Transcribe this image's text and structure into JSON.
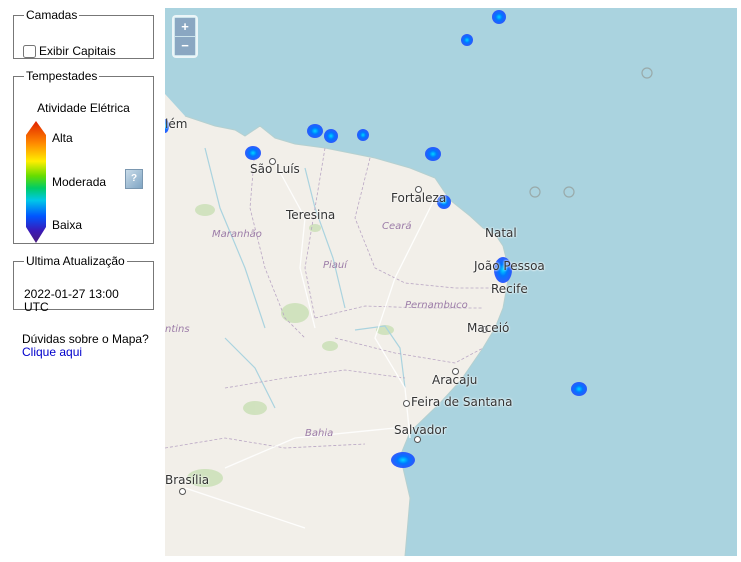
{
  "layers": {
    "legend": "Camadas",
    "show_capitals_label": "Exibir Capitais",
    "show_capitals_checked": false
  },
  "storms": {
    "legend": "Tempestades",
    "title": "Atividade Elétrica",
    "levels": {
      "high": "Alta",
      "moderate": "Moderada",
      "low": "Baixa"
    },
    "help_icon": "help-icon"
  },
  "update": {
    "legend": "Ultima Atualização",
    "timestamp": "2022-01-27 13:00 UTC"
  },
  "faq": {
    "question": "Dúvidas sobre o Mapa?",
    "link": "Clique aqui"
  },
  "map": {
    "zoom_in": "+",
    "zoom_out": "−",
    "cities": {
      "belem": "lém",
      "sao_luis": "São Luís",
      "teresina": "Teresina",
      "fortaleza": "Fortaleza",
      "natal": "Natal",
      "joao_pessoa": "João Pessoa",
      "recife": "Recife",
      "maceio": "Maceió",
      "aracaju": "Aracaju",
      "feira": "Feira de Santana",
      "salvador": "Salvador",
      "brasilia": "Brasília"
    },
    "states": {
      "maranhao": "Maranhão",
      "piaui": "Piauí",
      "ceara": "Ceará",
      "pernambuco": "Pernambuco",
      "bahia": "Bahia",
      "tocantins": "ntins"
    },
    "colors": {
      "ocean": "#aad3df",
      "land": "#f2efe9",
      "storm": "#1e6bff"
    }
  }
}
